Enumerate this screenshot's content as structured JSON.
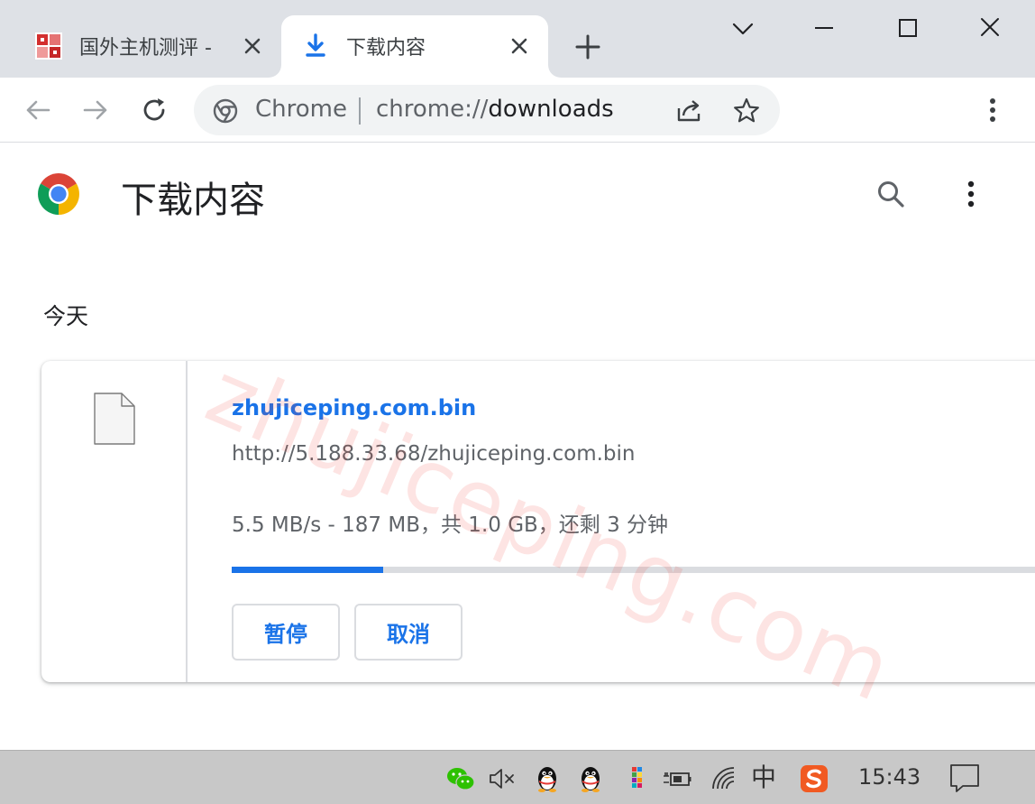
{
  "tabs": [
    {
      "title": "国外主机测评 -",
      "active": false,
      "favicon": "site-favicon-red"
    },
    {
      "title": "下载内容",
      "active": true,
      "favicon": "download-icon"
    }
  ],
  "toolbar": {
    "chip_label": "Chrome",
    "url_scheme": "chrome://",
    "url_path": "downloads"
  },
  "page": {
    "title": "下载内容",
    "section_label": "今天",
    "watermark": "zhujiceping.com"
  },
  "download": {
    "file_name": "zhujiceping.com.bin",
    "source_url": "http://5.188.33.68/zhujiceping.com.bin",
    "status": "5.5 MB/s - 187 MB，共 1.0 GB，还剩 3 分钟",
    "progress_fraction": 0.187,
    "pause_label": "暂停",
    "cancel_label": "取消"
  },
  "taskbar": {
    "ime_label": "中",
    "clock": "15:43"
  },
  "colors": {
    "accent": "#1a73e8",
    "tabstrip": "#dee1e6",
    "taskbar": "#c8c8c8"
  }
}
